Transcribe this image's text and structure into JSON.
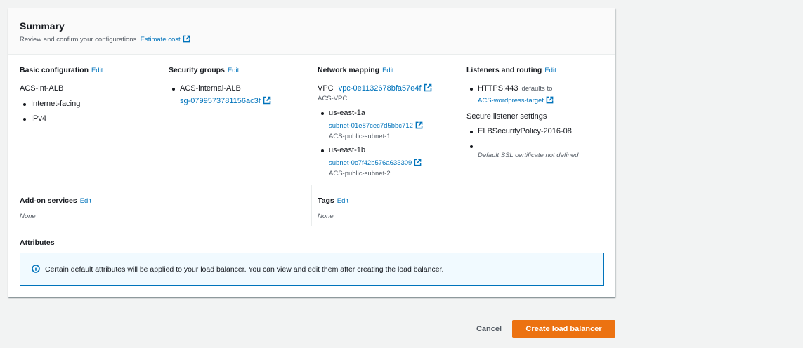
{
  "summary": {
    "title": "Summary",
    "description": "Review and confirm your configurations.",
    "estimate_cost_link": "Estimate cost"
  },
  "edit_label": "Edit",
  "basic": {
    "title": "Basic configuration",
    "name": "ACS-int-ALB",
    "items": [
      "Internet-facing",
      "IPv4"
    ]
  },
  "security": {
    "title": "Security groups",
    "group_name": "ACS-internal-ALB",
    "group_id": "sg-0799573781156ac3f"
  },
  "network": {
    "title": "Network mapping",
    "vpc_label": "VPC",
    "vpc_id": "vpc-0e1132678bfa57e4f",
    "vpc_name": "ACS-VPC",
    "zones": [
      {
        "az": "us-east-1a",
        "subnet_id": "subnet-01e87cec7d5bbc712",
        "subnet_name": "ACS-public-subnet-1"
      },
      {
        "az": "us-east-1b",
        "subnet_id": "subnet-0c7f42b576a633309",
        "subnet_name": "ACS-public-subnet-2"
      }
    ]
  },
  "listeners": {
    "title": "Listeners and routing",
    "listener": "HTTPS:443",
    "defaults_to": "defaults to",
    "target": "ACS-wordpress-target",
    "secure_title": "Secure listener settings",
    "policy": "ELBSecurityPolicy-2016-08",
    "cert_note": "Default SSL certificate not defined"
  },
  "addons": {
    "title": "Add-on services",
    "value": "None"
  },
  "tags": {
    "title": "Tags",
    "value": "None"
  },
  "attributes": {
    "title": "Attributes",
    "info": "Certain default attributes will be applied to your load balancer. You can view and edit them after creating the load balancer."
  },
  "actions": {
    "cancel": "Cancel",
    "create": "Create load balancer"
  },
  "colors": {
    "link": "#0073bb",
    "primary_button": "#ec7211",
    "info_border": "#0073bb",
    "info_bg": "#f1faff"
  }
}
